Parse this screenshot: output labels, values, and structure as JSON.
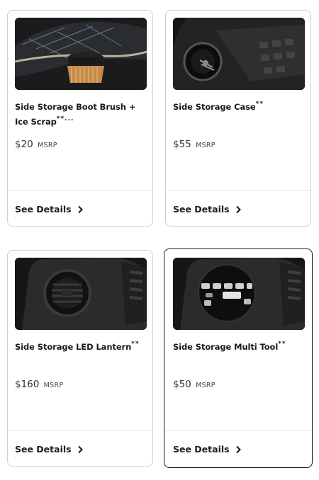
{
  "products": [
    {
      "title": "Side Storage Boot Brush + Ice Scrap",
      "title_suffix": "**...",
      "price": "$20",
      "price_unit": "MSRP",
      "cta": "See Details",
      "image": "boot-brush-photo"
    },
    {
      "title": "Side Storage Case",
      "title_suffix": "**",
      "price": "$55",
      "price_unit": "MSRP",
      "cta": "See Details",
      "image": "storage-case-photo"
    },
    {
      "title": "Side Storage LED Lantern",
      "title_suffix": "**",
      "price": "$160",
      "price_unit": "MSRP",
      "cta": "See Details",
      "image": "led-lantern-photo"
    },
    {
      "title": "Side Storage Multi Tool",
      "title_suffix": "**",
      "price": "$50",
      "price_unit": "MSRP",
      "cta": "See Details",
      "image": "multi-tool-photo",
      "selected": true
    }
  ],
  "colors": {
    "text": "#1a1a1a",
    "border": "#cfcfcf",
    "selected_border": "#1a1a1a"
  }
}
